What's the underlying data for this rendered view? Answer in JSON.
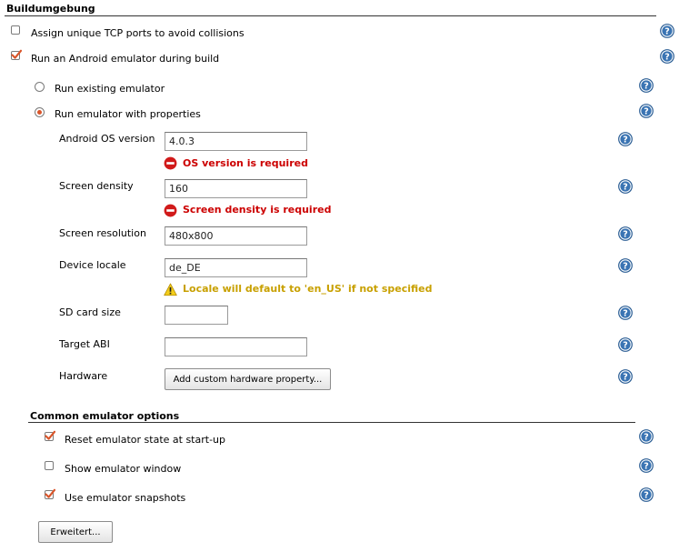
{
  "build_env": {
    "title": "Buildumgebung",
    "unique_ports_label": "Assign unique TCP ports to avoid collisions",
    "unique_ports_checked": false,
    "run_emulator_label": "Run an Android emulator during build",
    "run_emulator_checked": true
  },
  "emulator_mode": {
    "existing_label": "Run existing emulator",
    "existing_selected": false,
    "properties_label": "Run emulator with properties",
    "properties_selected": true
  },
  "properties": {
    "os_version_label": "Android OS version",
    "os_version_value": "4.0.3",
    "os_version_error": "OS version is required",
    "density_label": "Screen density",
    "density_value": "160",
    "density_error": "Screen density is required",
    "resolution_label": "Screen resolution",
    "resolution_value": "480x800",
    "locale_label": "Device locale",
    "locale_value": "de_DE",
    "locale_warning": "Locale will default to 'en_US' if not specified",
    "sdcard_label": "SD card size",
    "sdcard_value": "",
    "abi_label": "Target ABI",
    "abi_value": "",
    "hardware_label": "Hardware",
    "hardware_button": "Add custom hardware property..."
  },
  "common": {
    "title": "Common emulator options",
    "reset_label": "Reset emulator state at start-up",
    "reset_checked": true,
    "show_window_label": "Show emulator window",
    "show_window_checked": false,
    "snapshots_label": "Use emulator snapshots",
    "snapshots_checked": true,
    "advanced_button": "Erweitert..."
  },
  "colors": {
    "check_accent": "#d9552a",
    "error_text": "#cc0000",
    "warning_text": "#c8a000",
    "help_icon": "#2a5d94"
  },
  "icons": {
    "help": "help-icon",
    "error": "error-icon",
    "warning": "warning-icon"
  }
}
